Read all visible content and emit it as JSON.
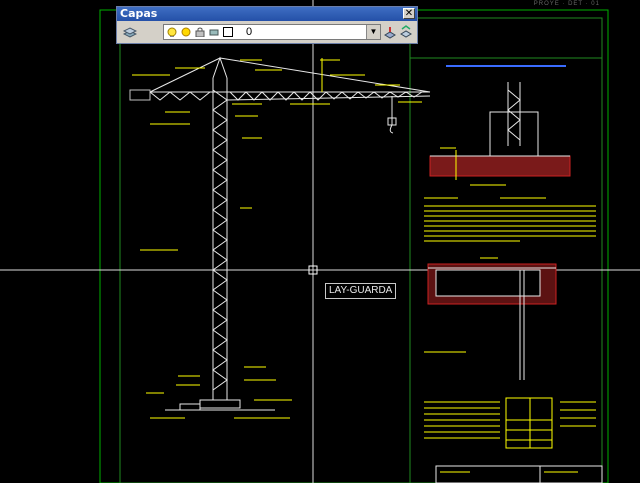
{
  "toolbar": {
    "title": "Capas",
    "close_label": "✕",
    "current_layer": "0",
    "icons": [
      "layer-manager-icon",
      "lightbulb-icon",
      "sun-icon",
      "lock-icon",
      "color-swatch-icon",
      "layer-previous-icon",
      "make-current-icon"
    ]
  },
  "tooltip": {
    "text": "LAY-GUARDA"
  },
  "drawing": {
    "top_right_label": "PROYE · DET · 01",
    "colors": {
      "background": "#000000",
      "linework": "#ffffff",
      "annotation": "#ffff00",
      "frame": "#00cc00",
      "hatch": "#cc2222",
      "title_blue": "#3a6cff"
    }
  }
}
